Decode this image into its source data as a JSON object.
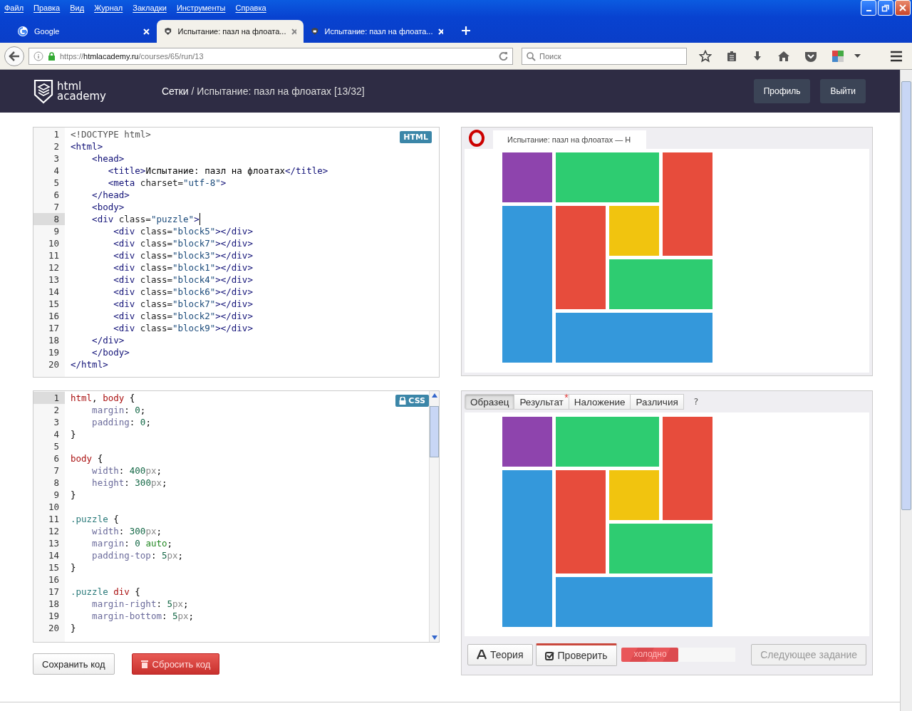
{
  "menu": [
    "Файл",
    "Правка",
    "Вид",
    "Журнал",
    "Закладки",
    "Инструменты",
    "Справка"
  ],
  "tabs": [
    {
      "title": "Google",
      "kind": "google",
      "selected": false
    },
    {
      "title": "Испытание: пазл на флоата...",
      "kind": "academy",
      "selected": true
    },
    {
      "title": "Испытание: пазл на флоата...",
      "kind": "academy",
      "selected": false
    }
  ],
  "address": {
    "scheme": "https://",
    "host": "htmlacademy.ru",
    "path": "/courses/65/run/13"
  },
  "search": {
    "placeholder": "Поиск"
  },
  "header": {
    "logo_top": "html",
    "logo_bottom": "academy",
    "section": "Сетки",
    "separator": " / ",
    "title": "Испытание: пазл на флоатах [13/32]",
    "buttons": [
      "Профиль",
      "Выйти"
    ]
  },
  "html_editor": {
    "badge": "HTML",
    "lines": [
      {
        "number": "1",
        "active": false,
        "text": "<!DOCTYPE html>"
      },
      {
        "number": "2",
        "active": false,
        "text": "<html>"
      },
      {
        "number": "3",
        "active": false,
        "text": "    <head>"
      },
      {
        "number": "4",
        "active": false,
        "text": "       <title>Испытание: пазл на флоатах</title>"
      },
      {
        "number": "5",
        "active": false,
        "text": "       <meta charset=\"utf-8\">"
      },
      {
        "number": "6",
        "active": false,
        "text": "    </head>"
      },
      {
        "number": "7",
        "active": false,
        "text": "    <body>"
      },
      {
        "number": "8",
        "active": true,
        "text": "    <div class=\"puzzle\">"
      },
      {
        "number": "9",
        "active": false,
        "text": "        <div class=\"block5\"></div>"
      },
      {
        "number": "10",
        "active": false,
        "text": "        <div class=\"block7\"></div>"
      },
      {
        "number": "11",
        "active": false,
        "text": "        <div class=\"block3\"></div>"
      },
      {
        "number": "12",
        "active": false,
        "text": "        <div class=\"block1\"></div>"
      },
      {
        "number": "13",
        "active": false,
        "text": "        <div class=\"block4\"></div>"
      },
      {
        "number": "14",
        "active": false,
        "text": "        <div class=\"block6\"></div>"
      },
      {
        "number": "15",
        "active": false,
        "text": "        <div class=\"block7\"></div>"
      },
      {
        "number": "16",
        "active": false,
        "text": "        <div class=\"block2\"></div>"
      },
      {
        "number": "17",
        "active": false,
        "text": "        <div class=\"block9\"></div>"
      },
      {
        "number": "18",
        "active": false,
        "text": "    </div>"
      },
      {
        "number": "19",
        "active": false,
        "text": "    </body>"
      },
      {
        "number": "20",
        "active": false,
        "text": "</html>"
      }
    ]
  },
  "css_editor": {
    "badge": "CSS",
    "locked": true,
    "lines": [
      {
        "number": "1",
        "active": true,
        "text": "html, body {"
      },
      {
        "number": "2",
        "active": false,
        "text": "    margin: 0;"
      },
      {
        "number": "3",
        "active": false,
        "text": "    padding: 0;"
      },
      {
        "number": "4",
        "active": false,
        "text": "}"
      },
      {
        "number": "5",
        "active": false
      },
      {
        "number": "6",
        "active": false,
        "text": "body {"
      },
      {
        "number": "7",
        "active": false,
        "text": "    width: 400px;"
      },
      {
        "number": "8",
        "active": false,
        "text": "    height: 300px;"
      },
      {
        "number": "9",
        "active": false,
        "text": "}"
      },
      {
        "number": "10",
        "active": false
      },
      {
        "number": "11",
        "active": false,
        "text": ".puzzle {"
      },
      {
        "number": "12",
        "active": false,
        "text": "    width: 300px;"
      },
      {
        "number": "13",
        "active": false,
        "text": "    margin: 0 auto;"
      },
      {
        "number": "14",
        "active": false,
        "text": "    padding-top: 5px;"
      },
      {
        "number": "15",
        "active": false,
        "text": "}"
      },
      {
        "number": "16",
        "active": false
      },
      {
        "number": "17",
        "active": false,
        "text": ".puzzle div {"
      },
      {
        "number": "18",
        "active": false,
        "text": "    margin-right: 5px;"
      },
      {
        "number": "19",
        "active": false,
        "text": "    margin-bottom: 5px;"
      },
      {
        "number": "20",
        "active": false,
        "text": "}"
      }
    ]
  },
  "editor_buttons": [
    {
      "label": "Сохранить код",
      "kind": "default"
    },
    {
      "label": "Сбросить код",
      "kind": "danger"
    }
  ],
  "preview": {
    "tab_title": "Испытание: пазл на флоатах — Н",
    "blocks": [
      {
        "color": "#8e44ad"
      },
      {
        "color": "#2ecc71"
      },
      {
        "color": "#e74c3c"
      },
      {
        "color": "#3498db"
      },
      {
        "color": "#e74c3c"
      },
      {
        "color": "#f1c40f"
      },
      {
        "color": "#2ecc71"
      },
      {
        "color": "#3498db"
      }
    ]
  },
  "result": {
    "tabs": [
      {
        "label": "Образец",
        "selected": true
      },
      {
        "label": "Результат",
        "selected": false,
        "marker": "*"
      },
      {
        "label": "Наложение",
        "selected": false
      },
      {
        "label": "Различия",
        "selected": false
      }
    ],
    "help": "?",
    "blocks": [
      {
        "color": "#8e44ad"
      },
      {
        "color": "#2ecc71"
      },
      {
        "color": "#e74c3c"
      },
      {
        "color": "#3498db"
      },
      {
        "color": "#e74c3c"
      },
      {
        "color": "#f1c40f"
      },
      {
        "color": "#2ecc71"
      },
      {
        "color": "#3498db"
      }
    ]
  },
  "actions": {
    "theory": "Теория",
    "check": "Проверить",
    "temperature": {
      "label": "холодно",
      "level": 0.5
    },
    "next": {
      "label": "Следующее задание",
      "disabled": true
    }
  }
}
